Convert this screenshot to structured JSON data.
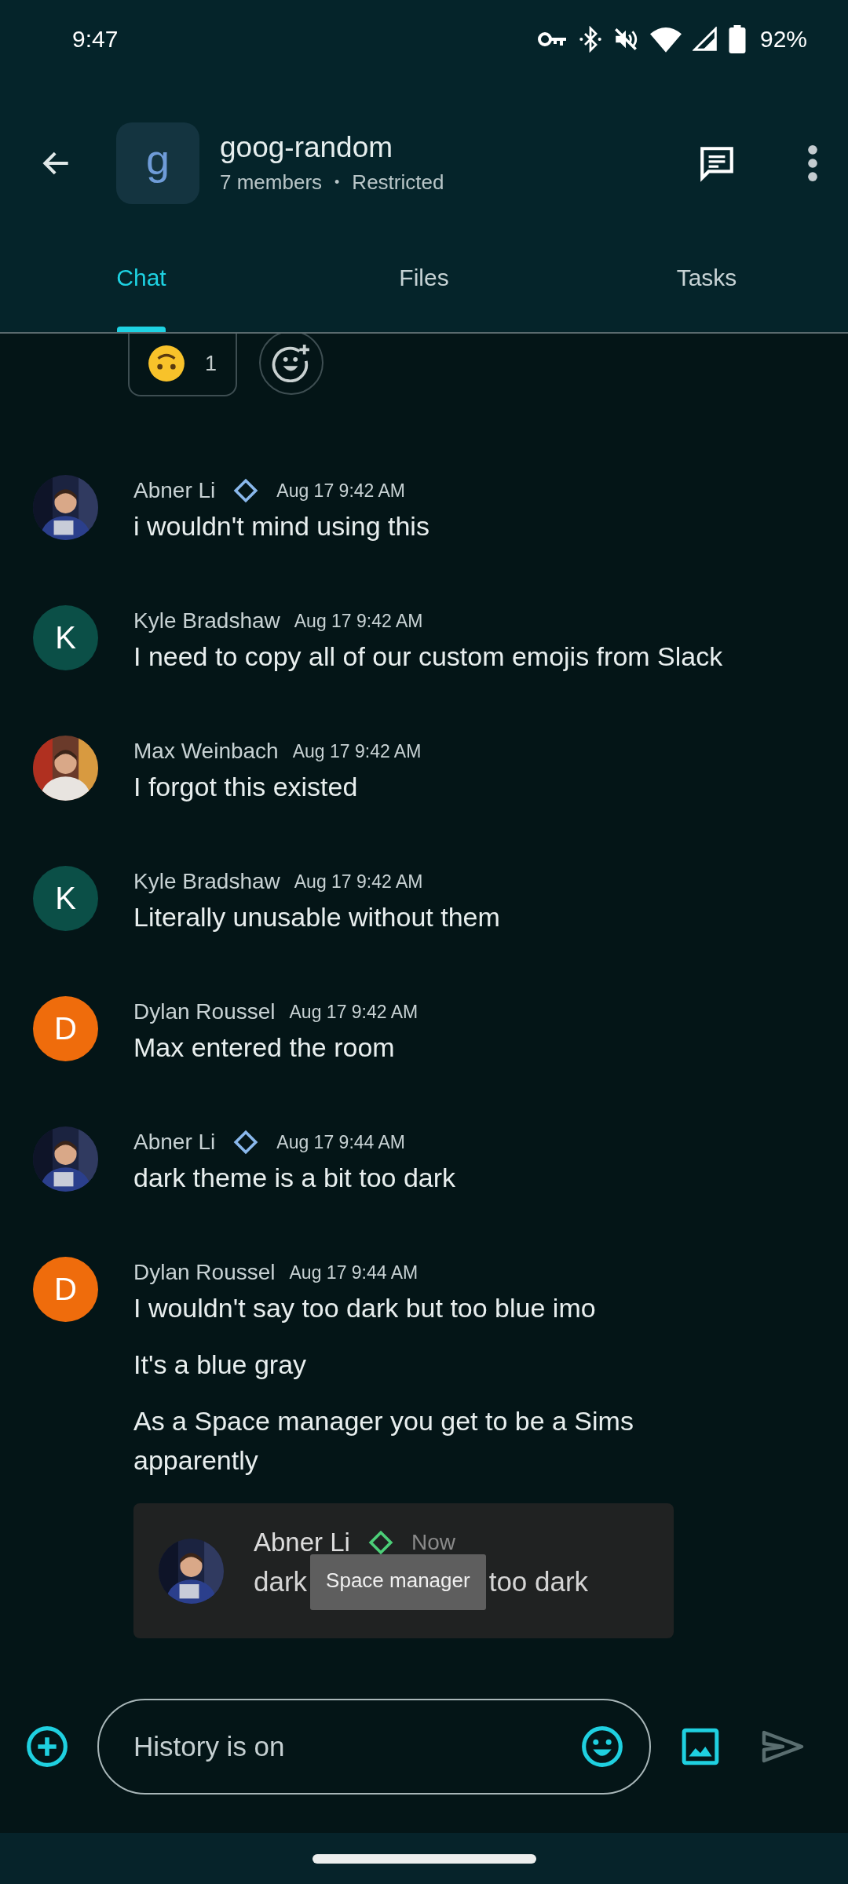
{
  "status_bar": {
    "time": "9:47",
    "battery": "92%"
  },
  "header": {
    "avatar_letter": "g",
    "title": "goog-random",
    "members": "7 members",
    "separator": "•",
    "access": "Restricted"
  },
  "tabs": [
    {
      "label": "Chat",
      "selected": true
    },
    {
      "label": "Files",
      "selected": false
    },
    {
      "label": "Tasks",
      "selected": false
    }
  ],
  "reactions": [
    {
      "count": "1"
    }
  ],
  "messages": [
    {
      "author": "Abner Li",
      "manager_badge": true,
      "time": "Aug 17 9:42 AM",
      "texts": [
        "i wouldn't mind using this"
      ]
    },
    {
      "author": "Kyle Bradshaw",
      "avatar": {
        "kind": "letter",
        "letter": "K",
        "color": "#0b4f47"
      },
      "manager_badge": false,
      "time": "Aug 17 9:42 AM",
      "texts": [
        "I need to copy all of our custom emojis from Slack"
      ]
    },
    {
      "author": "Max Weinbach",
      "manager_badge": false,
      "time": "Aug 17 9:42 AM",
      "texts": [
        "I forgot this existed"
      ]
    },
    {
      "author": "Kyle Bradshaw",
      "avatar": {
        "kind": "letter",
        "letter": "K",
        "color": "#0b4f47"
      },
      "manager_badge": false,
      "time": "Aug 17 9:42 AM",
      "texts": [
        "Literally unusable without them"
      ]
    },
    {
      "author": "Dylan Roussel",
      "avatar": {
        "kind": "letter",
        "letter": "D",
        "color": "#ef6c0c"
      },
      "manager_badge": false,
      "time": "Aug 17 9:42 AM",
      "texts": [
        "Max entered the room"
      ]
    },
    {
      "author": "Abner Li",
      "manager_badge": true,
      "time": "Aug 17 9:44 AM",
      "texts": [
        "dark theme is a bit too dark"
      ]
    },
    {
      "author": "Dylan Roussel",
      "avatar": {
        "kind": "letter",
        "letter": "D",
        "color": "#ef6c0c"
      },
      "manager_badge": false,
      "time": "Aug 17 9:44 AM",
      "texts": [
        "I wouldn't say too dark but too blue imo",
        "It's a blue gray",
        "As a Space manager you get to be a Sims apparently"
      ],
      "attachment": {
        "kind": "screenshot",
        "author": "Abner Li",
        "manager_badge": true,
        "time": "Now",
        "text_before": "dark",
        "tooltip": "Space manager",
        "text_after": "too dark"
      }
    }
  ],
  "composer": {
    "placeholder": "History is on"
  }
}
